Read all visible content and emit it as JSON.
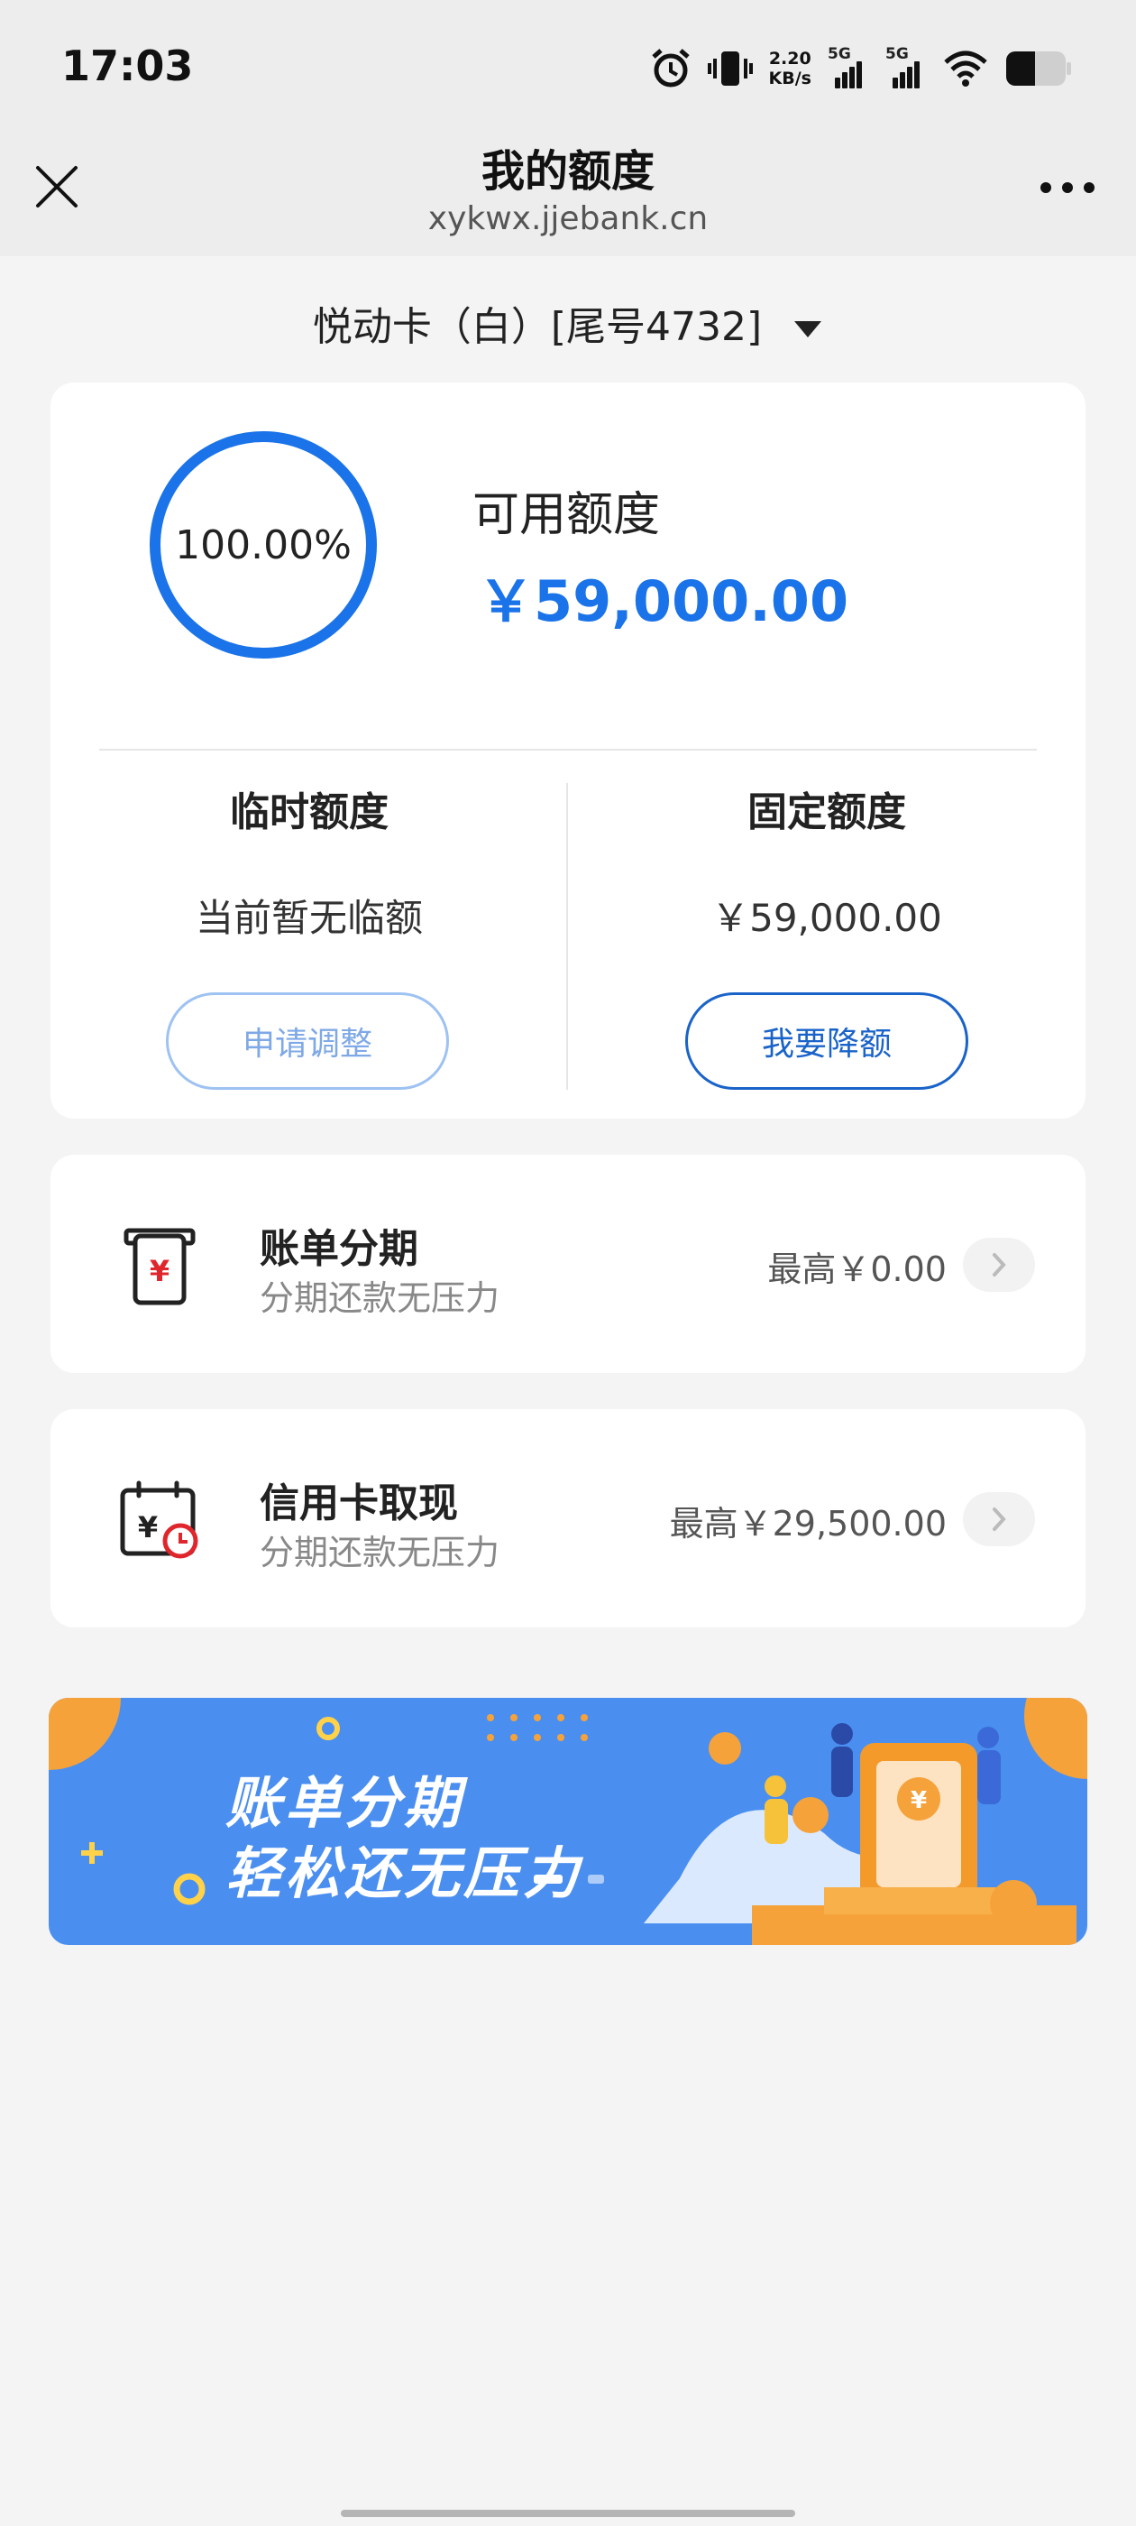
{
  "status_bar": {
    "time": "17:03",
    "speed_value": "2.20",
    "speed_unit": "KB/s",
    "sim1": "5G",
    "sim2": "5G"
  },
  "nav": {
    "title": "我的额度",
    "url": "xykwx.jjebank.cn"
  },
  "card_selector": {
    "label": "悦动卡（白）[尾号4732]"
  },
  "credit": {
    "percent_text": "100.00%",
    "percent_value": 1.0,
    "available_label": "可用额度",
    "available_value": "￥59,000.00"
  },
  "temp_limit": {
    "title": "临时额度",
    "value": "当前暂无临额",
    "button": "申请调整"
  },
  "fixed_limit": {
    "title": "固定额度",
    "value": "￥59,000.00",
    "button": "我要降额"
  },
  "rows": [
    {
      "title": "账单分期",
      "subtitle": "分期还款无压力",
      "value": "最高￥0.00"
    },
    {
      "title": "信用卡取现",
      "subtitle": "分期还款无压力",
      "value": "最高￥29,500.00"
    }
  ],
  "banner": {
    "line1": "账单分期",
    "line2": "轻松还无压力"
  },
  "colors": {
    "accent": "#1a73e8",
    "banner_bg": "#4a8ff0",
    "icon_red": "#e0262d"
  }
}
